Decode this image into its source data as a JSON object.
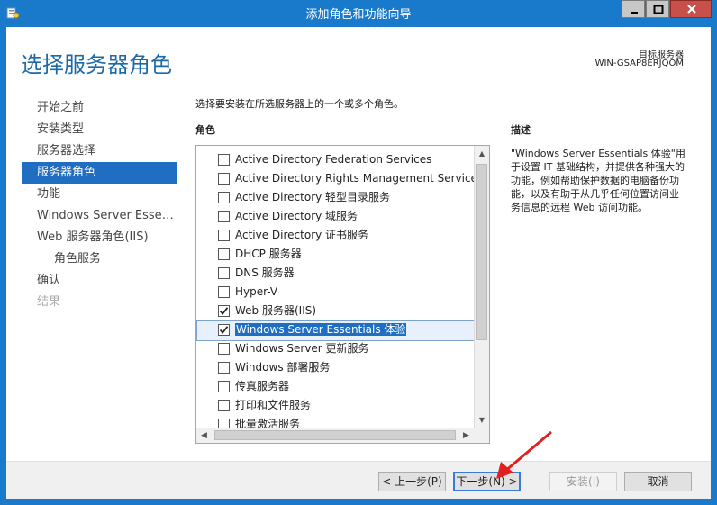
{
  "window": {
    "title": "添加角色和功能向导",
    "icon": "server-manager-icon",
    "controls": [
      "minimize-icon",
      "maximize-icon",
      "close-icon"
    ]
  },
  "header": {
    "title": "选择服务器角色",
    "target_label": "目标服务器",
    "target_value": "WIN-GSAP8ERJQOM"
  },
  "nav": {
    "items": [
      {
        "label": "开始之前",
        "state": "normal"
      },
      {
        "label": "安装类型",
        "state": "normal"
      },
      {
        "label": "服务器选择",
        "state": "normal"
      },
      {
        "label": "服务器角色",
        "state": "active"
      },
      {
        "label": "功能",
        "state": "normal"
      },
      {
        "label": "Windows Server Essenti...",
        "state": "normal"
      },
      {
        "label": "Web 服务器角色(IIS)",
        "state": "normal"
      },
      {
        "label": "角色服务",
        "state": "sub"
      },
      {
        "label": "确认",
        "state": "normal"
      },
      {
        "label": "结果",
        "state": "disabled"
      }
    ]
  },
  "main": {
    "intro": "选择要安装在所选服务器上的一个或多个角色。",
    "roles_heading": "角色",
    "description_heading": "描述",
    "description": "\"Windows Server Essentials 体验\"用于设置 IT 基础结构，并提供各种强大的功能，例如帮助保护数据的电脑备份功能，以及有助于从几乎任何位置访问业务信息的远程 Web 访问功能。",
    "roles": [
      {
        "label": "Active Directory Federation Services",
        "checked": false,
        "selected": false
      },
      {
        "label": "Active Directory Rights Management Services",
        "checked": false,
        "selected": false
      },
      {
        "label": "Active Directory 轻型目录服务",
        "checked": false,
        "selected": false
      },
      {
        "label": "Active Directory 域服务",
        "checked": false,
        "selected": false
      },
      {
        "label": "Active Directory 证书服务",
        "checked": false,
        "selected": false
      },
      {
        "label": "DHCP 服务器",
        "checked": false,
        "selected": false
      },
      {
        "label": "DNS 服务器",
        "checked": false,
        "selected": false
      },
      {
        "label": "Hyper-V",
        "checked": false,
        "selected": false
      },
      {
        "label": "Web 服务器(IIS)",
        "checked": true,
        "selected": false
      },
      {
        "label": "Windows Server Essentials 体验",
        "checked": true,
        "selected": true
      },
      {
        "label": "Windows Server 更新服务",
        "checked": false,
        "selected": false
      },
      {
        "label": "Windows 部署服务",
        "checked": false,
        "selected": false
      },
      {
        "label": "传真服务器",
        "checked": false,
        "selected": false
      },
      {
        "label": "打印和文件服务",
        "checked": false,
        "selected": false
      },
      {
        "label": "批量激活服务",
        "checked": false,
        "selected": false
      }
    ]
  },
  "buttons": {
    "prev": "< 上一步(P)",
    "next": "下一步(N) >",
    "install": "安装(I)",
    "cancel": "取消"
  },
  "colors": {
    "chrome": "#1979ca",
    "title_blue": "#1e6aa8",
    "selection": "#1f6ec2",
    "annotation_arrow": "#e02020"
  }
}
